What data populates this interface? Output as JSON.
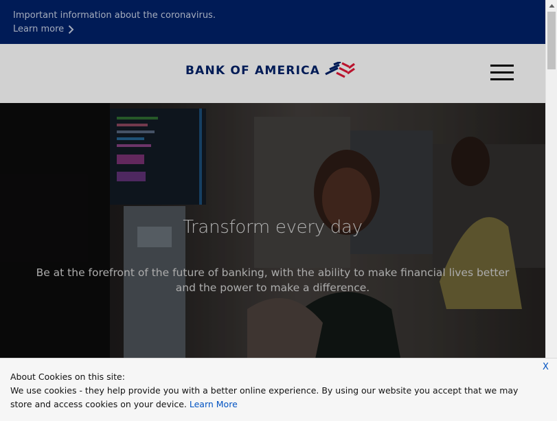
{
  "alert": {
    "text": "Important information about the coronavirus.",
    "link_label": "Learn more",
    "link_icon": "chevron-right-icon"
  },
  "header": {
    "logo_text": "BANK OF AMERICA",
    "logo_icon": "flag-logo-icon",
    "menu_icon": "hamburger-menu-icon"
  },
  "hero": {
    "title": "Transform every day",
    "description": "Be at the forefront of the future of banking, with the ability to make financial lives better and the power to make a difference."
  },
  "cookie": {
    "title": "About Cookies on this site:",
    "body": "We use cookies - they help provide you with a better online experience. By using our website you accept that we may store and access cookies on your device. ",
    "link_label": "Learn More",
    "close_label": "X"
  },
  "colors": {
    "brand_navy": "#012169",
    "brand_red": "#e31837",
    "link_blue": "#0052c2"
  }
}
